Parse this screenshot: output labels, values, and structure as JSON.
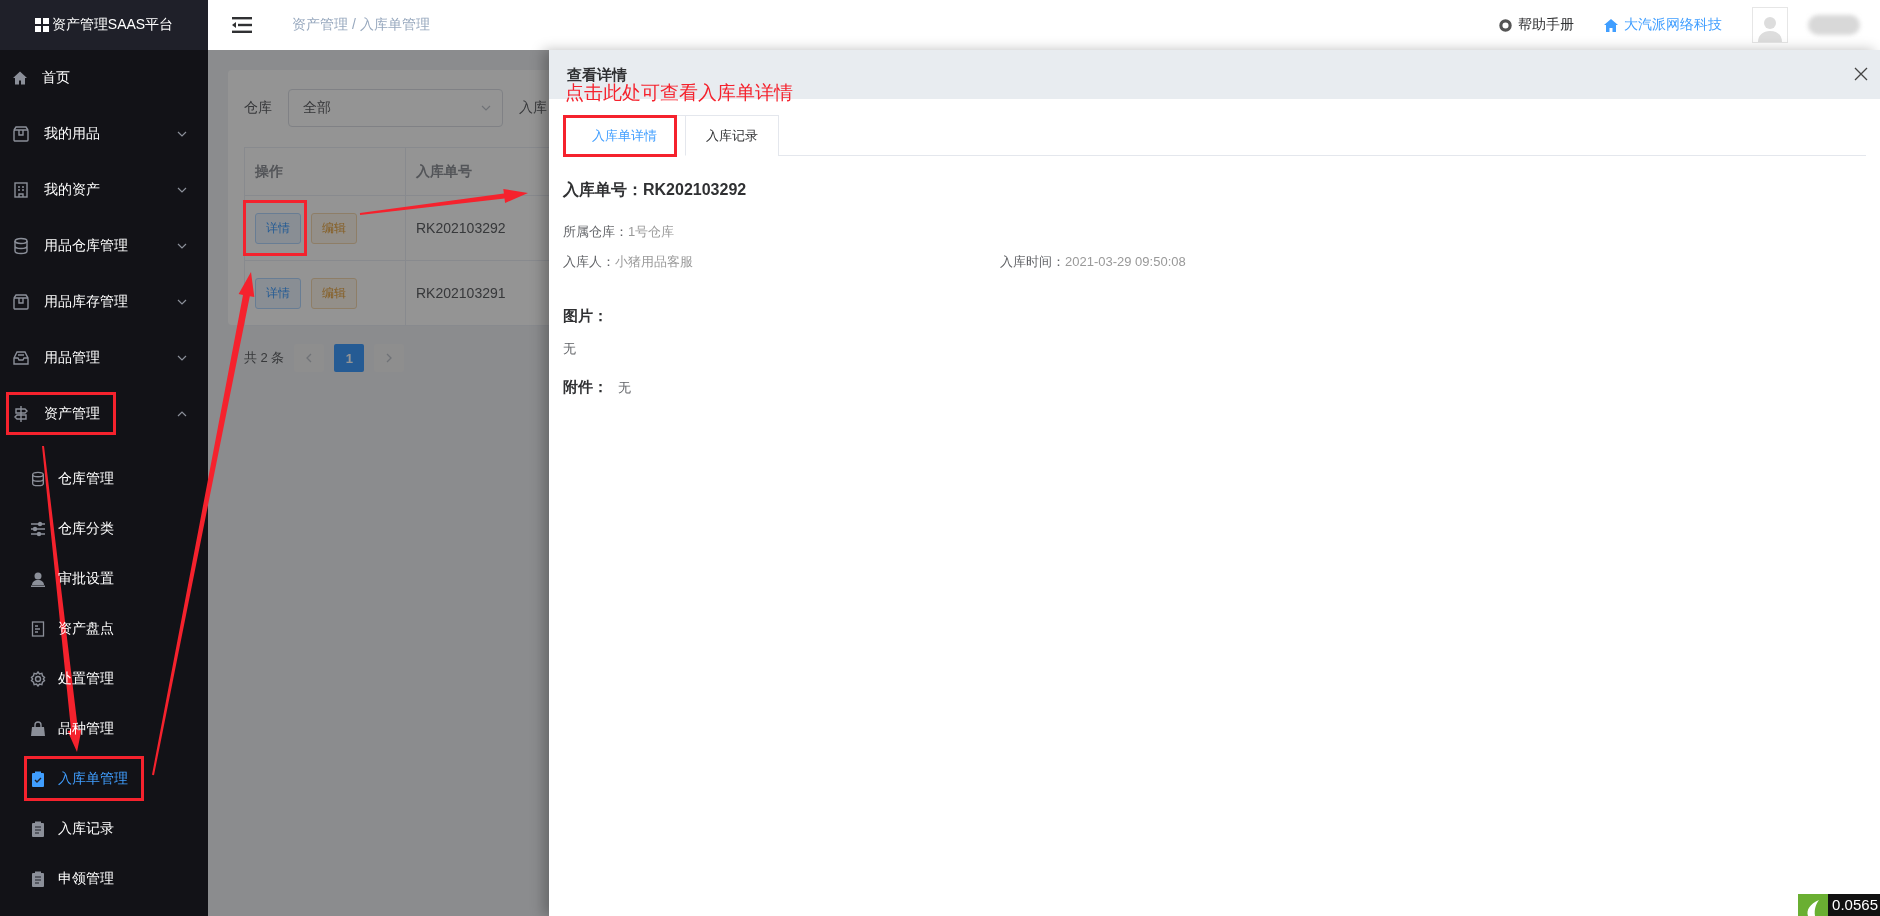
{
  "app_title": "资产管理SAAS平台",
  "sidebar": {
    "items": [
      {
        "label": "首页",
        "selected": false
      },
      {
        "label": "我的用品",
        "selected": false,
        "expanded": false
      },
      {
        "label": "我的资产",
        "selected": false,
        "expanded": false
      },
      {
        "label": "用品仓库管理",
        "selected": false,
        "expanded": false
      },
      {
        "label": "用品库存管理",
        "selected": false,
        "expanded": false
      },
      {
        "label": "用品管理",
        "selected": false,
        "expanded": false
      },
      {
        "label": "资产管理",
        "selected": false,
        "expanded": true,
        "children": [
          {
            "label": "仓库管理",
            "selected": false
          },
          {
            "label": "仓库分类",
            "selected": false
          },
          {
            "label": "审批设置",
            "selected": false
          },
          {
            "label": "资产盘点",
            "selected": false
          },
          {
            "label": "处置管理",
            "selected": false
          },
          {
            "label": "品种管理",
            "selected": false
          },
          {
            "label": "入库单管理",
            "selected": true
          },
          {
            "label": "入库记录",
            "selected": false
          },
          {
            "label": "申领管理",
            "selected": false
          }
        ]
      }
    ]
  },
  "header": {
    "breadcrumb": "资产管理 / 入库单管理",
    "help_link": "帮助手册",
    "company_link": "大汽派网络科技"
  },
  "background_page": {
    "filter": {
      "label": "仓库",
      "value": "全部",
      "next_label": "入库"
    },
    "table": {
      "columns": [
        "操作",
        "入库单号"
      ],
      "rows": [
        {
          "actions": [
            "详情",
            "编辑"
          ],
          "number": "RK202103292"
        },
        {
          "actions": [
            "详情",
            "编辑"
          ],
          "number": "RK202103291"
        }
      ]
    },
    "pagination": {
      "total": "共 2 条",
      "pages": [
        {
          "label": "1",
          "selected": true
        }
      ]
    }
  },
  "drawer": {
    "title": "查看详情",
    "annotation": "点击此处可查看入库单详情",
    "tabs": [
      {
        "label": "入库单详情",
        "selected": true
      },
      {
        "label": "入库记录",
        "selected": false
      }
    ],
    "heading": "入库单号：RK202103292",
    "field_rows": [
      [
        {
          "label": "所属仓库：",
          "value": "1号仓库"
        }
      ],
      [
        {
          "label": "入库人：",
          "value": "小猪用品客服"
        },
        {
          "label": "入库时间：",
          "value": "2021-03-29 09:50:08"
        }
      ]
    ],
    "images_label": "图片：",
    "images_value": "无",
    "attachments_label": "附件：",
    "attachments_value": "无"
  },
  "corner_badge": {
    "text": "0.0565"
  }
}
